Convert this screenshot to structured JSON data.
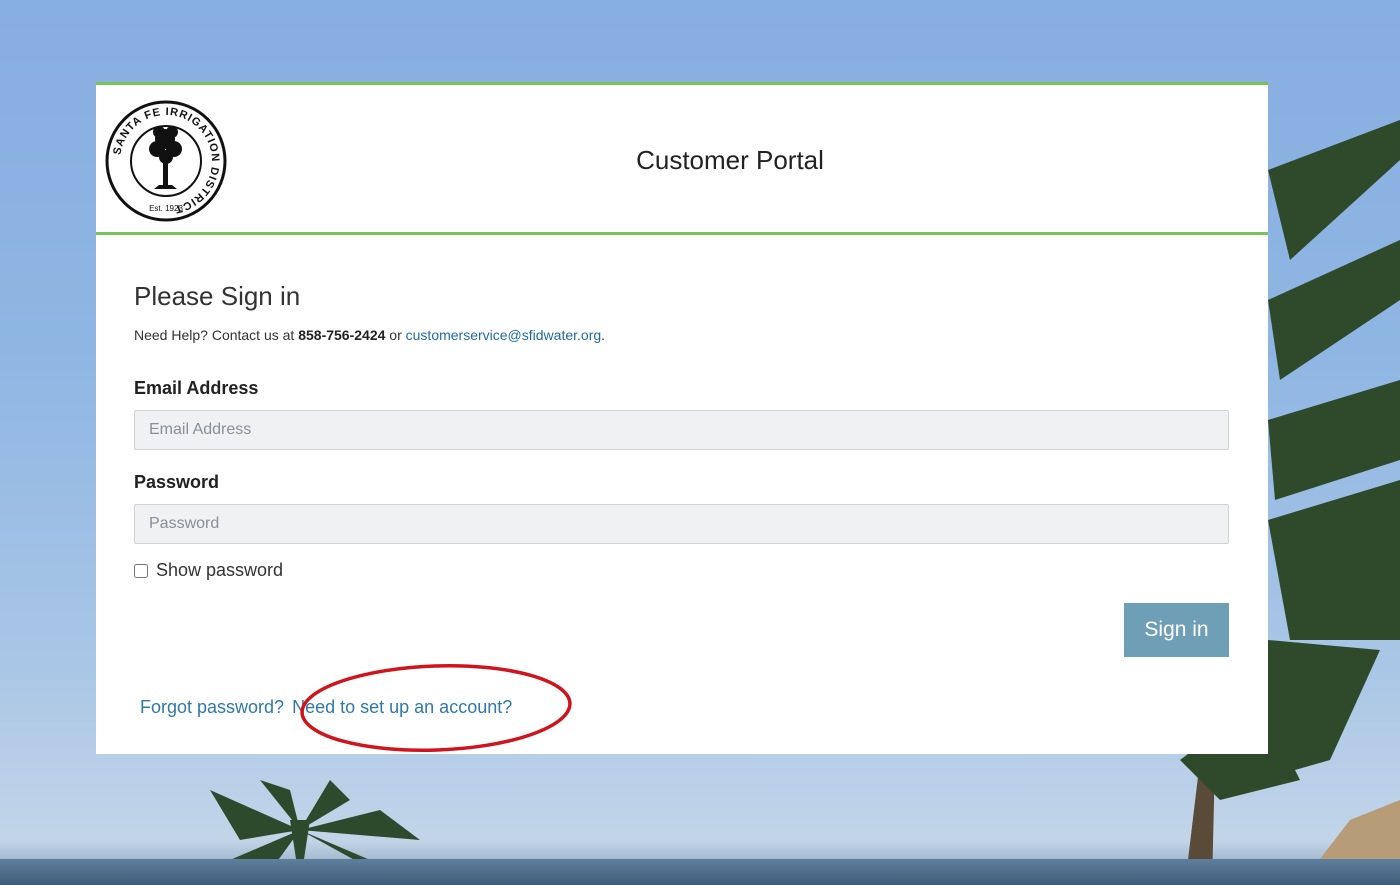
{
  "header": {
    "title": "Customer Portal",
    "logo": {
      "ring_text": "SANTA FE IRRIGATION DISTRICT",
      "est_text": "Est. 1923",
      "icon": "tree-icon"
    }
  },
  "signin": {
    "heading": "Please Sign in",
    "help_prefix": "Need Help? Contact us at",
    "phone": "858-756-2424",
    "help_or": "or",
    "email_link": "customerservice@sfidwater.org",
    "period": "."
  },
  "form": {
    "email_label": "Email Address",
    "email_placeholder": "Email Address",
    "email_value": "",
    "password_label": "Password",
    "password_placeholder": "Password",
    "password_value": "",
    "show_password_label": "Show password",
    "show_password_checked": false,
    "submit_label": "Sign in"
  },
  "links": {
    "forgot": "Forgot password?",
    "setup": "Need to set up an account?"
  },
  "colors": {
    "accent_green": "#79c35d",
    "button": "#6e9fb6",
    "link": "#2f79a8",
    "annotation_red": "#d0141c"
  }
}
